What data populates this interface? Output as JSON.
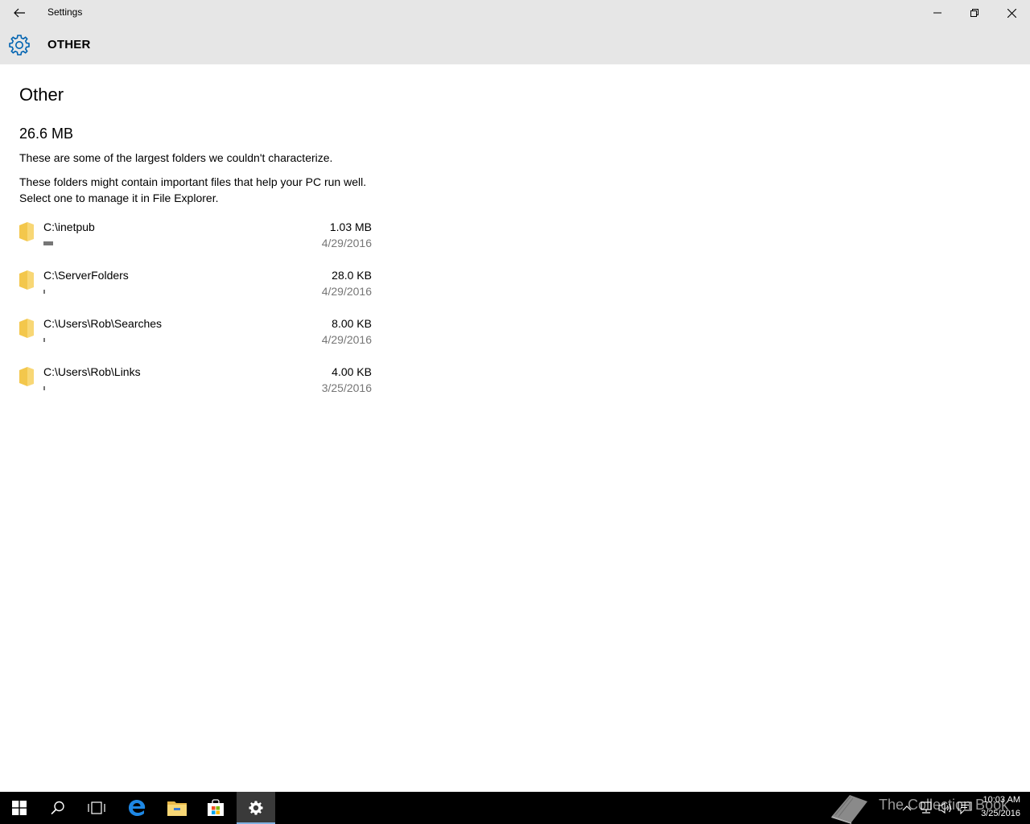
{
  "window": {
    "title": "Settings"
  },
  "header": {
    "title": "OTHER"
  },
  "main": {
    "page_title": "Other",
    "total_size": "26.6 MB",
    "description_1": "These are some of the largest folders we couldn't characterize.",
    "description_2": "These folders might contain important files that help your PC run well. Select one to manage it in File Explorer.",
    "folders": [
      {
        "path": "C:\\inetpub",
        "size": "1.03 MB",
        "date": "4/29/2016",
        "usage_fraction": 0.04
      },
      {
        "path": "C:\\ServerFolders",
        "size": "28.0 KB",
        "date": "4/29/2016",
        "usage_fraction": 0.005
      },
      {
        "path": "C:\\Users\\Rob\\Searches",
        "size": "8.00 KB",
        "date": "4/29/2016",
        "usage_fraction": 0.003
      },
      {
        "path": "C:\\Users\\Rob\\Links",
        "size": "4.00 KB",
        "date": "3/25/2016",
        "usage_fraction": 0.002
      }
    ]
  },
  "taskbar": {
    "watermark": "The Collection Book",
    "clock_time": "10:03 AM",
    "clock_date": "3/25/2016"
  },
  "colors": {
    "accent": "#0063b1",
    "chrome": "#e6e6e6",
    "folder": "#f8d775",
    "taskbar": "#000000"
  }
}
